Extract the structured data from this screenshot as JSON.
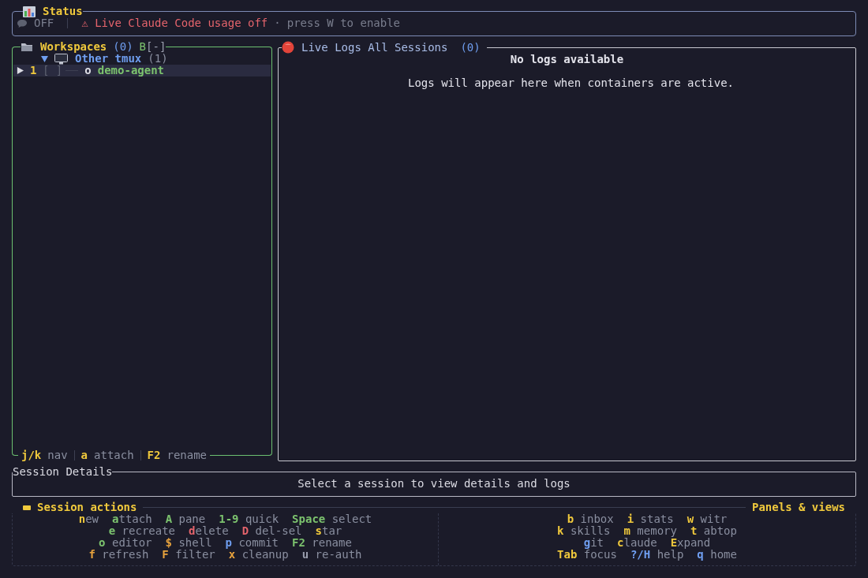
{
  "status": {
    "title": "Status",
    "state": "OFF",
    "warning": "⚠ Live Claude Code usage off",
    "separator": "·",
    "hint": "press W to enable"
  },
  "workspaces": {
    "title": "Workspaces",
    "count": "(0)",
    "toggle_key": "B",
    "toggle": "[-]",
    "groups": [
      {
        "name": "Other tmux",
        "count": "(1)",
        "expanded": true,
        "children": [
          {
            "index": "1",
            "checkbox": "[ ]",
            "status": "o",
            "name": "demo-agent",
            "selected": true
          }
        ]
      }
    ],
    "footer": [
      {
        "key": "j/k",
        "label": "nav"
      },
      {
        "key": "a",
        "label": "attach"
      },
      {
        "key": "F2",
        "label": "rename"
      }
    ]
  },
  "logs": {
    "title": "Live Logs All Sessions",
    "count": "(0)",
    "empty_title": "No logs available",
    "empty_message": "Logs will appear here when containers are active."
  },
  "session_details": {
    "title": "Session Details",
    "message": "Select a session to view details and logs"
  },
  "help": {
    "left_title": "Session actions",
    "right_title": "Panels & views",
    "left_rows": [
      [
        {
          "key": "n",
          "label": "ew",
          "color": "#f0c93c",
          "joined": true
        },
        {
          "key": "a",
          "label": "ttach",
          "color": "#7cc36e",
          "joined": true
        },
        {
          "key": "A",
          "label": "pane",
          "color": "#7cc36e",
          "joined": false
        },
        {
          "key": "1-9",
          "label": "quick",
          "color": "#7cc36e",
          "joined": false
        },
        {
          "key": "Space",
          "label": "select",
          "color": "#7cc36e",
          "joined": false
        }
      ],
      [
        {
          "key": "e",
          "label": "recreate",
          "color": "#7cc36e",
          "joined": false
        },
        {
          "key": "d",
          "label": "elete",
          "color": "#e5646c",
          "joined": true
        },
        {
          "key": "D",
          "label": "del-sel",
          "color": "#e5646c",
          "joined": false
        },
        {
          "key": "s",
          "label": "tar",
          "color": "#f0c93c",
          "joined": true
        }
      ],
      [
        {
          "key": "o",
          "label": "editor",
          "color": "#7cc36e",
          "joined": false
        },
        {
          "key": "$",
          "label": "shell",
          "color": "#e8a33d",
          "joined": false
        },
        {
          "key": "p",
          "label": "commit",
          "color": "#6f9ef0",
          "joined": false
        },
        {
          "key": "F2",
          "label": "rename",
          "color": "#7cc36e",
          "joined": false
        }
      ],
      [
        {
          "key": "f",
          "label": "refresh",
          "color": "#e8a33d",
          "joined": false
        },
        {
          "key": "F",
          "label": "filter",
          "color": "#e8a33d",
          "joined": false
        },
        {
          "key": "x",
          "label": "cleanup",
          "color": "#e8a33d",
          "joined": false
        },
        {
          "key": "u",
          "label": "re-auth",
          "color": "#9a9eae",
          "joined": false
        }
      ]
    ],
    "right_rows": [
      [
        {
          "key": "b",
          "label": "inbox",
          "color": "#f0c93c",
          "joined": false
        },
        {
          "key": "i",
          "label": "stats",
          "color": "#f0c93c",
          "joined": false
        },
        {
          "key": "w",
          "label": "witr",
          "color": "#f0c93c",
          "joined": false
        }
      ],
      [
        {
          "key": "k",
          "label": "skills",
          "color": "#f0c93c",
          "joined": false
        },
        {
          "key": "m",
          "label": "memory",
          "color": "#f0c93c",
          "joined": false
        },
        {
          "key": "t",
          "label": "abtop",
          "color": "#f0c93c",
          "joined": false
        }
      ],
      [
        {
          "key": "g",
          "label": "it",
          "color": "#6f9ef0",
          "joined": true
        },
        {
          "key": "c",
          "label": "laude",
          "color": "#f0c93c",
          "joined": true
        },
        {
          "key": "E",
          "label": "xpand",
          "color": "#f0c93c",
          "joined": true
        }
      ],
      [
        {
          "key": "Tab",
          "label": "focus",
          "color": "#f0c93c",
          "joined": false
        },
        {
          "key": "?/H",
          "label": "help",
          "color": "#6f9ef0",
          "joined": false
        },
        {
          "key": "q",
          "label": "home",
          "color": "#6f9ef0",
          "joined": false
        }
      ]
    ]
  }
}
